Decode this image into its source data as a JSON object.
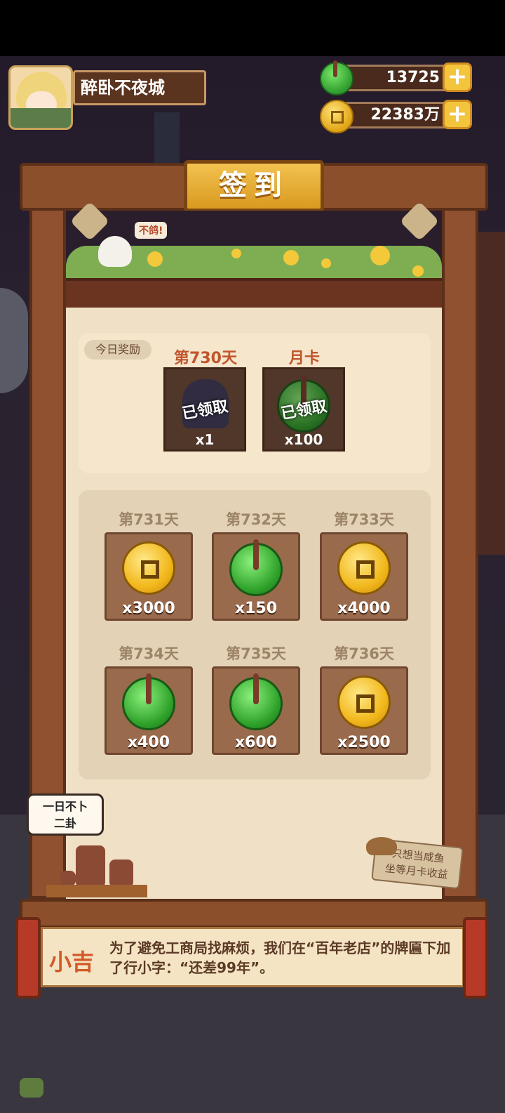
{
  "player": {
    "name": "醉卧不夜城"
  },
  "resources": {
    "jade": "13725",
    "coins": "22383万",
    "add_symbol": "+"
  },
  "panel": {
    "title": "签到"
  },
  "banner": {
    "bird_bubble": "不鸽!"
  },
  "today": {
    "tag": "今日奖励",
    "rewards": [
      {
        "label": "第730天",
        "status": "已领取",
        "qty": "x1"
      },
      {
        "label": "月卡",
        "status": "已领取",
        "qty": "x100"
      }
    ]
  },
  "upcoming": [
    {
      "label": "第731天",
      "item": "coin",
      "qty": "x3000"
    },
    {
      "label": "第732天",
      "item": "jade",
      "qty": "x150"
    },
    {
      "label": "第733天",
      "item": "coin",
      "qty": "x4000"
    },
    {
      "label": "第734天",
      "item": "jade",
      "qty": "x400"
    },
    {
      "label": "第735天",
      "item": "jade",
      "qty": "x600"
    },
    {
      "label": "第736天",
      "item": "coin",
      "qty": "x2500"
    }
  ],
  "decor": {
    "speech": "一日不卜\n二卦",
    "sign": "只想当咸鱼\n坐等月卡收益"
  },
  "dialog": {
    "speaker": "小吉",
    "text": "为了避免工商局找麻烦，我们在“百年老店”的牌匾下加了行小字：“还差99年”。"
  },
  "colors": {
    "accent_gold": "#f3c53d",
    "frame_wood": "#8c4f2c",
    "title_red": "#c0552c"
  }
}
